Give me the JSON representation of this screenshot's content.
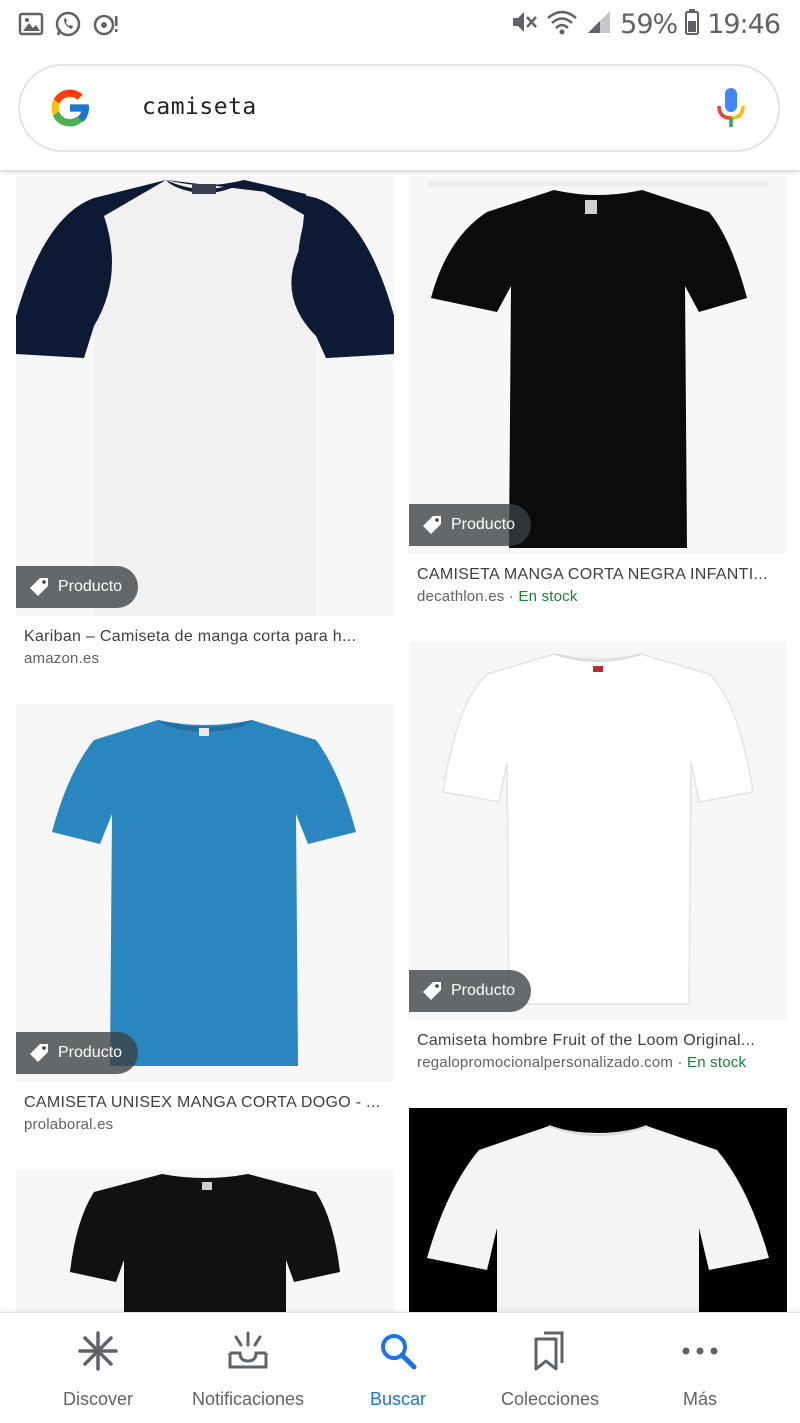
{
  "status_bar": {
    "battery": "59%",
    "time": "19:46",
    "left_icons": [
      "gallery-icon",
      "whatsapp-icon",
      "sync-icon"
    ],
    "right_icons": [
      "mute-icon",
      "wifi-icon",
      "signal-icon",
      "battery-icon"
    ]
  },
  "search": {
    "query": "camiseta",
    "logo_icon": "google-g-icon",
    "mic_icon": "mic-icon"
  },
  "results": [
    {
      "title": "Kariban – Camiseta de manga corta para h...",
      "source": "amazon.es",
      "stock": "",
      "badge": "Producto",
      "image": "white-raglan-shirt-navy-sleeves"
    },
    {
      "title": "CAMISETA MANGA CORTA NEGRA INFANTI...",
      "source": "decathlon.es",
      "stock": "En stock",
      "badge": "Producto",
      "image": "black-tshirt"
    },
    {
      "title": "CAMISETA UNISEX MANGA CORTA DOGO - ...",
      "source": "prolaboral.es",
      "stock": "",
      "badge": "Producto",
      "image": "blue-tshirt"
    },
    {
      "title": "Camiseta hombre Fruit of the Loom Original...",
      "source": "regalopromocionalpersonalizado.com",
      "stock": "En stock",
      "badge": "Producto",
      "image": "white-tshirt"
    },
    {
      "title": "",
      "source": "",
      "stock": "",
      "badge": "",
      "image": "black-tshirt-partial"
    },
    {
      "title": "",
      "source": "",
      "stock": "",
      "badge": "",
      "image": "white-tshirt-on-black-partial"
    }
  ],
  "separator": " · ",
  "nav": [
    {
      "label": "Discover",
      "icon": "discover-icon",
      "active": false
    },
    {
      "label": "Notificaciones",
      "icon": "notifications-icon",
      "active": false
    },
    {
      "label": "Buscar",
      "icon": "search-icon",
      "active": true
    },
    {
      "label": "Colecciones",
      "icon": "collections-icon",
      "active": false
    },
    {
      "label": "Más",
      "icon": "more-icon",
      "active": false
    }
  ],
  "colors": {
    "accent": "#1a73e8",
    "stock_green": "#188038",
    "chip_bg": "#3c4043"
  }
}
